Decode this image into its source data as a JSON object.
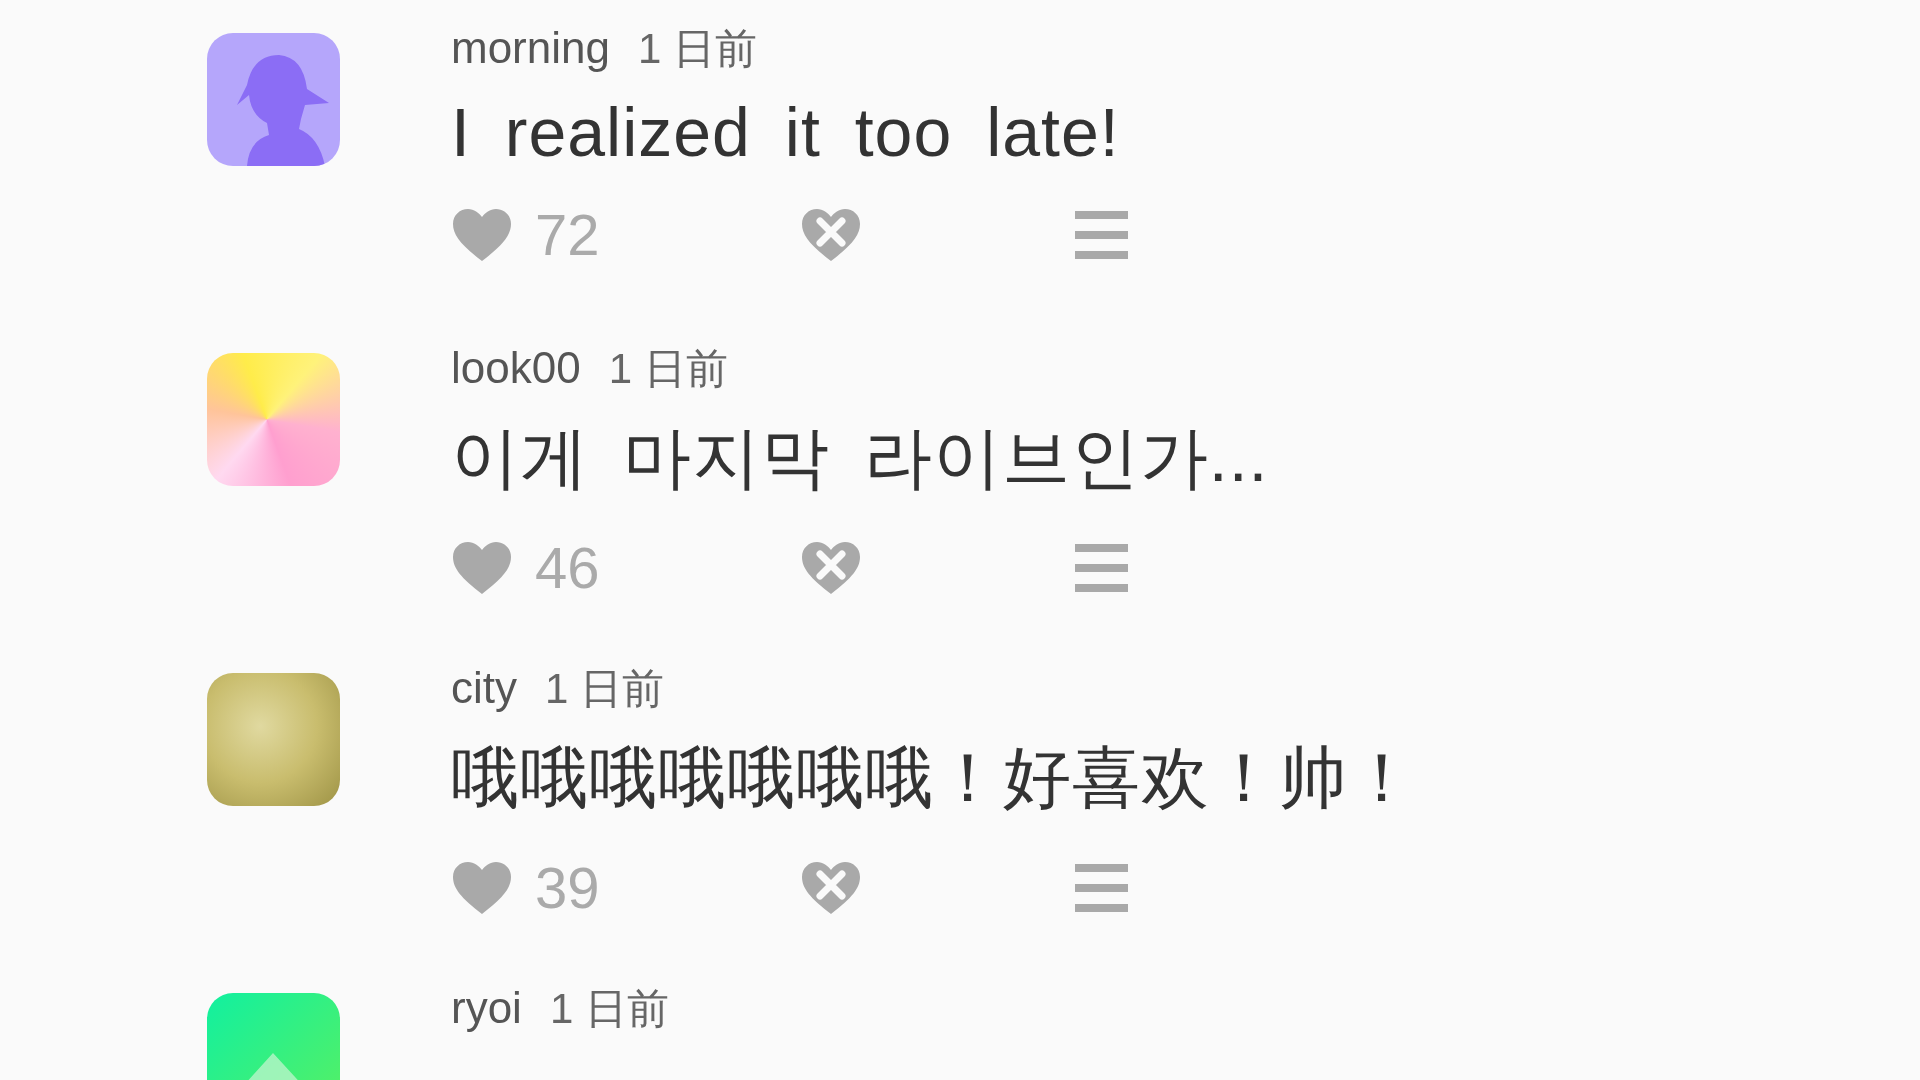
{
  "comments": [
    {
      "kind": "silhouette",
      "user": "morning",
      "time": "1 日前",
      "text": "I realized it too late!",
      "likes": "72"
    },
    {
      "kind": "abstract",
      "user": "look00",
      "time": "1 日前",
      "text": "이게 마지막 라이브인가...",
      "likes": "46"
    },
    {
      "kind": "photo",
      "user": "city",
      "time": "1 日前",
      "text": "哦哦哦哦哦哦哦！好喜欢！帅！",
      "likes": "39"
    },
    {
      "kind": "chevron",
      "user": "ryoi",
      "time": "1 日前"
    }
  ]
}
